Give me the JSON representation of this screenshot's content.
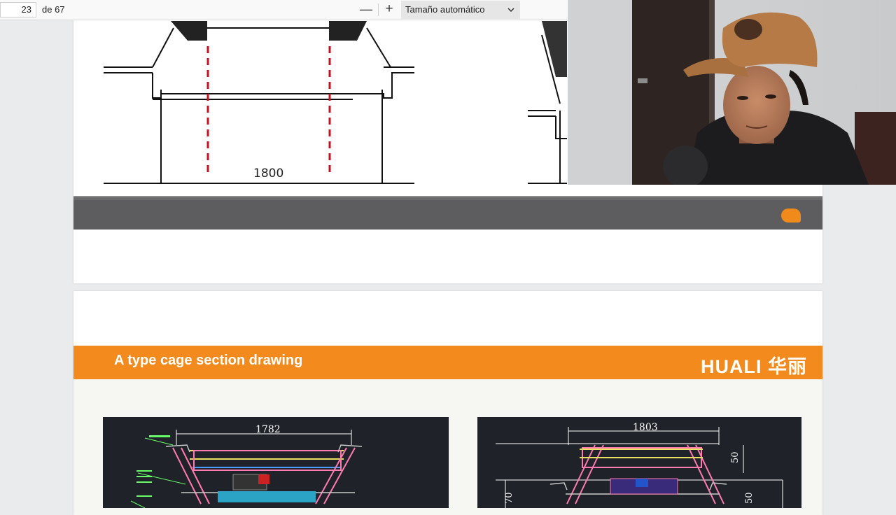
{
  "toolbar": {
    "page_number": "23",
    "page_total": "de 67",
    "zoom_out": "—",
    "zoom_in": "+",
    "zoom_value": "Tamaño automático",
    "dropdown_icon": "chevron-down-icon"
  },
  "page1": {
    "drawing_dimension": "1800",
    "accent_color": "#f08a1a"
  },
  "page2": {
    "banner_title": "A type cage section drawing",
    "logo_text": "HUALI 华丽",
    "banner_color": "#f28a1d",
    "cad_left_dimension": "1782",
    "cad_right_dimension": "1803",
    "cad_right_side_dim_1": "50",
    "cad_right_side_dim_2": "70",
    "cad_right_side_dim_3": "50"
  }
}
